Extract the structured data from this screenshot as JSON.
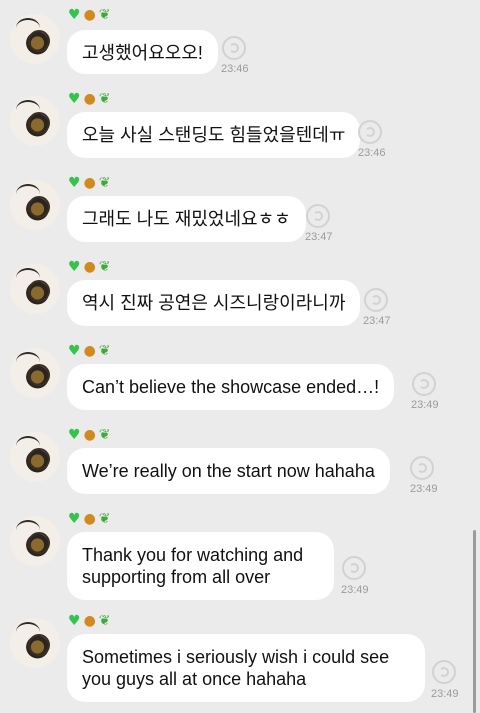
{
  "sender": {
    "name_emoji": "💚🐯🌱"
  },
  "messages": [
    {
      "text": "고생했어요오오!",
      "time": "23:46"
    },
    {
      "text": "오늘 사실 스탠딩도 힘들었을텐데ㅠ",
      "time": "23:46"
    },
    {
      "text": "그래도 나도 재밌었네요ㅎㅎ",
      "time": "23:47"
    },
    {
      "text": "역시 진짜 공연은 시즈니랑이라니까",
      "time": "23:47"
    },
    {
      "text": "Can’t believe the showcase ended…!",
      "time": "23:49"
    },
    {
      "text": "We’re really on the start now hahaha",
      "time": "23:49"
    },
    {
      "text": "Thank you for watching and supporting from all over",
      "time": "23:49"
    },
    {
      "text": "Sometimes i seriously wish i could see you guys all at once hahaha",
      "time": "23:49"
    }
  ]
}
